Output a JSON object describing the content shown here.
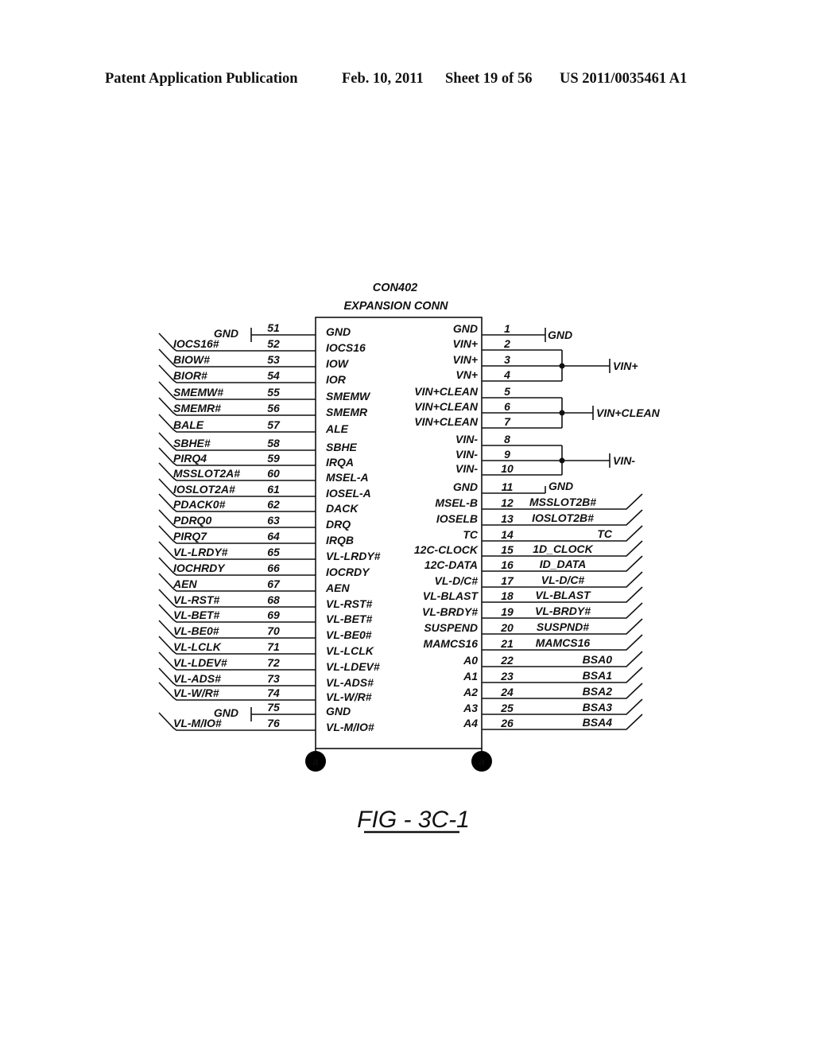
{
  "header": {
    "publication": "Patent Application Publication",
    "date": "Feb. 10, 2011",
    "sheet": "Sheet 19 of 56",
    "number": "US 2011/0035461 A1"
  },
  "connector": {
    "ref": "CON402",
    "name": "EXPANSION CONN"
  },
  "left_pins": [
    {
      "pin": "51",
      "internal": "GND",
      "net": "",
      "ground": "GND"
    },
    {
      "pin": "52",
      "internal": "IOCS16",
      "net": "IOCS16#"
    },
    {
      "pin": "53",
      "internal": "IOW",
      "net": "BIOW#"
    },
    {
      "pin": "54",
      "internal": "IOR",
      "net": "BIOR#"
    },
    {
      "pin": "55",
      "internal": "SMEMW",
      "net": "SMEMW#"
    },
    {
      "pin": "56",
      "internal": "SMEMR",
      "net": "SMEMR#"
    },
    {
      "pin": "57",
      "internal": "ALE",
      "net": "BALE"
    },
    {
      "pin": "58",
      "internal": "SBHE",
      "net": "SBHE#"
    },
    {
      "pin": "59",
      "internal": "IRQA",
      "net": "PIRQ4"
    },
    {
      "pin": "60",
      "internal": "MSEL-A",
      "net": "MSSLOT2A#"
    },
    {
      "pin": "61",
      "internal": "IOSEL-A",
      "net": "IOSLOT2A#"
    },
    {
      "pin": "62",
      "internal": "DACK",
      "net": "PDACK0#"
    },
    {
      "pin": "63",
      "internal": "DRQ",
      "net": "PDRQ0"
    },
    {
      "pin": "64",
      "internal": "IRQB",
      "net": "PIRQ7"
    },
    {
      "pin": "65",
      "internal": "VL-LRDY#",
      "net": "VL-LRDY#"
    },
    {
      "pin": "66",
      "internal": "IOCRDY",
      "net": "IOCHRDY"
    },
    {
      "pin": "67",
      "internal": "AEN",
      "net": "AEN"
    },
    {
      "pin": "68",
      "internal": "VL-RST#",
      "net": "VL-RST#"
    },
    {
      "pin": "69",
      "internal": "VL-BET#",
      "net": "VL-BET#"
    },
    {
      "pin": "70",
      "internal": "VL-BE0#",
      "net": "VL-BE0#"
    },
    {
      "pin": "71",
      "internal": "VL-LCLK",
      "net": "VL-LCLK"
    },
    {
      "pin": "72",
      "internal": "VL-LDEV#",
      "net": "VL-LDEV#"
    },
    {
      "pin": "73",
      "internal": "VL-ADS#",
      "net": "VL-ADS#"
    },
    {
      "pin": "74",
      "internal": "VL-W/R#",
      "net": "VL-W/R#"
    },
    {
      "pin": "75",
      "internal": "GND",
      "net": "",
      "ground": "GND"
    },
    {
      "pin": "76",
      "internal": "VL-M/IO#",
      "net": "VL-M/IO#"
    }
  ],
  "right_pins": [
    {
      "pin": "1",
      "internal": "GND",
      "net": "GND",
      "kind": "ground"
    },
    {
      "pin": "2",
      "internal": "VIN+",
      "net": "",
      "kind": "bus",
      "group": 0
    },
    {
      "pin": "3",
      "internal": "VIN+",
      "net": "",
      "kind": "bus",
      "group": 0
    },
    {
      "pin": "4",
      "internal": "VN+",
      "net": "",
      "kind": "bus",
      "group": 0
    },
    {
      "pin": "5",
      "internal": "VIN+CLEAN",
      "net": "",
      "kind": "bus",
      "group": 1
    },
    {
      "pin": "6",
      "internal": "VIN+CLEAN",
      "net": "",
      "kind": "bus",
      "group": 1
    },
    {
      "pin": "7",
      "internal": "VIN+CLEAN",
      "net": "",
      "kind": "bus",
      "group": 1
    },
    {
      "pin": "8",
      "internal": "VIN-",
      "net": "",
      "kind": "bus",
      "group": 2
    },
    {
      "pin": "9",
      "internal": "VIN-",
      "net": "",
      "kind": "bus",
      "group": 2
    },
    {
      "pin": "10",
      "internal": "VIN-",
      "net": "",
      "kind": "bus",
      "group": 2
    },
    {
      "pin": "11",
      "internal": "GND",
      "net": "GND",
      "kind": "ground-short"
    },
    {
      "pin": "12",
      "internal": "MSEL-B",
      "net": "MSSLOT2B#",
      "kind": "signal"
    },
    {
      "pin": "13",
      "internal": "IOSELB",
      "net": "IOSLOT2B#",
      "kind": "signal"
    },
    {
      "pin": "14",
      "internal": "TC",
      "net": "TC",
      "kind": "signal"
    },
    {
      "pin": "15",
      "internal": "12C-CLOCK",
      "net": "1D_CLOCK",
      "kind": "signal"
    },
    {
      "pin": "16",
      "internal": "12C-DATA",
      "net": "ID_DATA",
      "kind": "signal"
    },
    {
      "pin": "17",
      "internal": "VL-D/C#",
      "net": "VL-D/C#",
      "kind": "signal"
    },
    {
      "pin": "18",
      "internal": "VL-BLAST",
      "net": "VL-BLAST",
      "kind": "signal"
    },
    {
      "pin": "19",
      "internal": "VL-BRDY#",
      "net": "VL-BRDY#",
      "kind": "signal"
    },
    {
      "pin": "20",
      "internal": "SUSPEND",
      "net": "SUSPND#",
      "kind": "signal"
    },
    {
      "pin": "21",
      "internal": "MAMCS16",
      "net": "MAMCS16",
      "kind": "signal"
    },
    {
      "pin": "22",
      "internal": "A0",
      "net": "BSA0",
      "kind": "signal"
    },
    {
      "pin": "23",
      "internal": "A1",
      "net": "BSA1",
      "kind": "signal"
    },
    {
      "pin": "24",
      "internal": "A2",
      "net": "BSA2",
      "kind": "signal"
    },
    {
      "pin": "25",
      "internal": "A3",
      "net": "BSA3",
      "kind": "signal"
    },
    {
      "pin": "26",
      "internal": "A4",
      "net": "BSA4",
      "kind": "signal"
    }
  ],
  "bus_groups": [
    {
      "label": "VIN+"
    },
    {
      "label": "VIN+CLEAN"
    },
    {
      "label": "VIN-"
    }
  ],
  "offpage": {
    "left": "a",
    "right": "a"
  },
  "figure_label": "FIG - 3C-1"
}
